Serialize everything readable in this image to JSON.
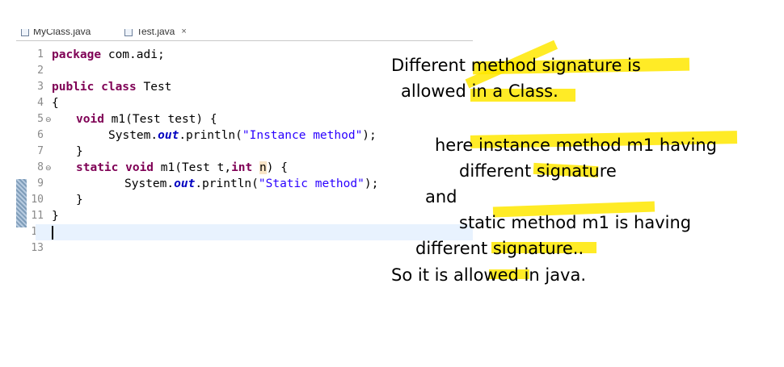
{
  "editor": {
    "tabs": [
      {
        "label": "MyClass.java",
        "active": false
      },
      {
        "label": "Test.java",
        "active": true,
        "close": "×"
      }
    ],
    "lines": [
      {
        "number": "1",
        "fold": ""
      },
      {
        "number": "2",
        "fold": ""
      },
      {
        "number": "3",
        "fold": ""
      },
      {
        "number": "4",
        "fold": ""
      },
      {
        "number": "5",
        "fold": "⊖"
      },
      {
        "number": "6",
        "fold": ""
      },
      {
        "number": "7",
        "fold": ""
      },
      {
        "number": "8",
        "fold": "⊖"
      },
      {
        "number": "9",
        "fold": ""
      },
      {
        "number": "10",
        "fold": ""
      },
      {
        "number": "11",
        "fold": ""
      },
      {
        "number": "12",
        "fold": ""
      },
      {
        "number": "13",
        "fold": ""
      }
    ],
    "code": {
      "l1_kw": "package",
      "l1_rest": " com.adi;",
      "l3_kw": "public class",
      "l3_rest": " Test",
      "l4": "{",
      "l5_kw": "void",
      "l5_rest": " m1(Test test) {",
      "l6_pre": "System.",
      "l6_field": "out",
      "l6_mid": ".println(",
      "l6_str": "\"Instance method\"",
      "l6_end": ");",
      "l7": "}",
      "l8_kw": "static void",
      "l8_mid": " m1(Test t,",
      "l8_kw2": "int",
      "l8_sp": " ",
      "l8_var": "n",
      "l8_end": ") {",
      "l9_pre": "System.",
      "l9_field": "out",
      "l9_mid": ".println(",
      "l9_str": "\"Static method\"",
      "l9_end": ");",
      "l10": "}",
      "l11": "}"
    }
  },
  "annotation": {
    "line1": "Different method signature is",
    "line2": "allowed in a Class.",
    "line3": "here instance method m1 having",
    "line4": "different signature",
    "line5": "and",
    "line6": "static method m1 is having",
    "line7": "different signature..",
    "line8": "So it is allowed in java."
  },
  "colors": {
    "highlighter": "#ffe800",
    "keyword": "#7f0055",
    "string": "#2a00ff",
    "field": "#0000c0",
    "current_line": "#e8f2fe"
  }
}
